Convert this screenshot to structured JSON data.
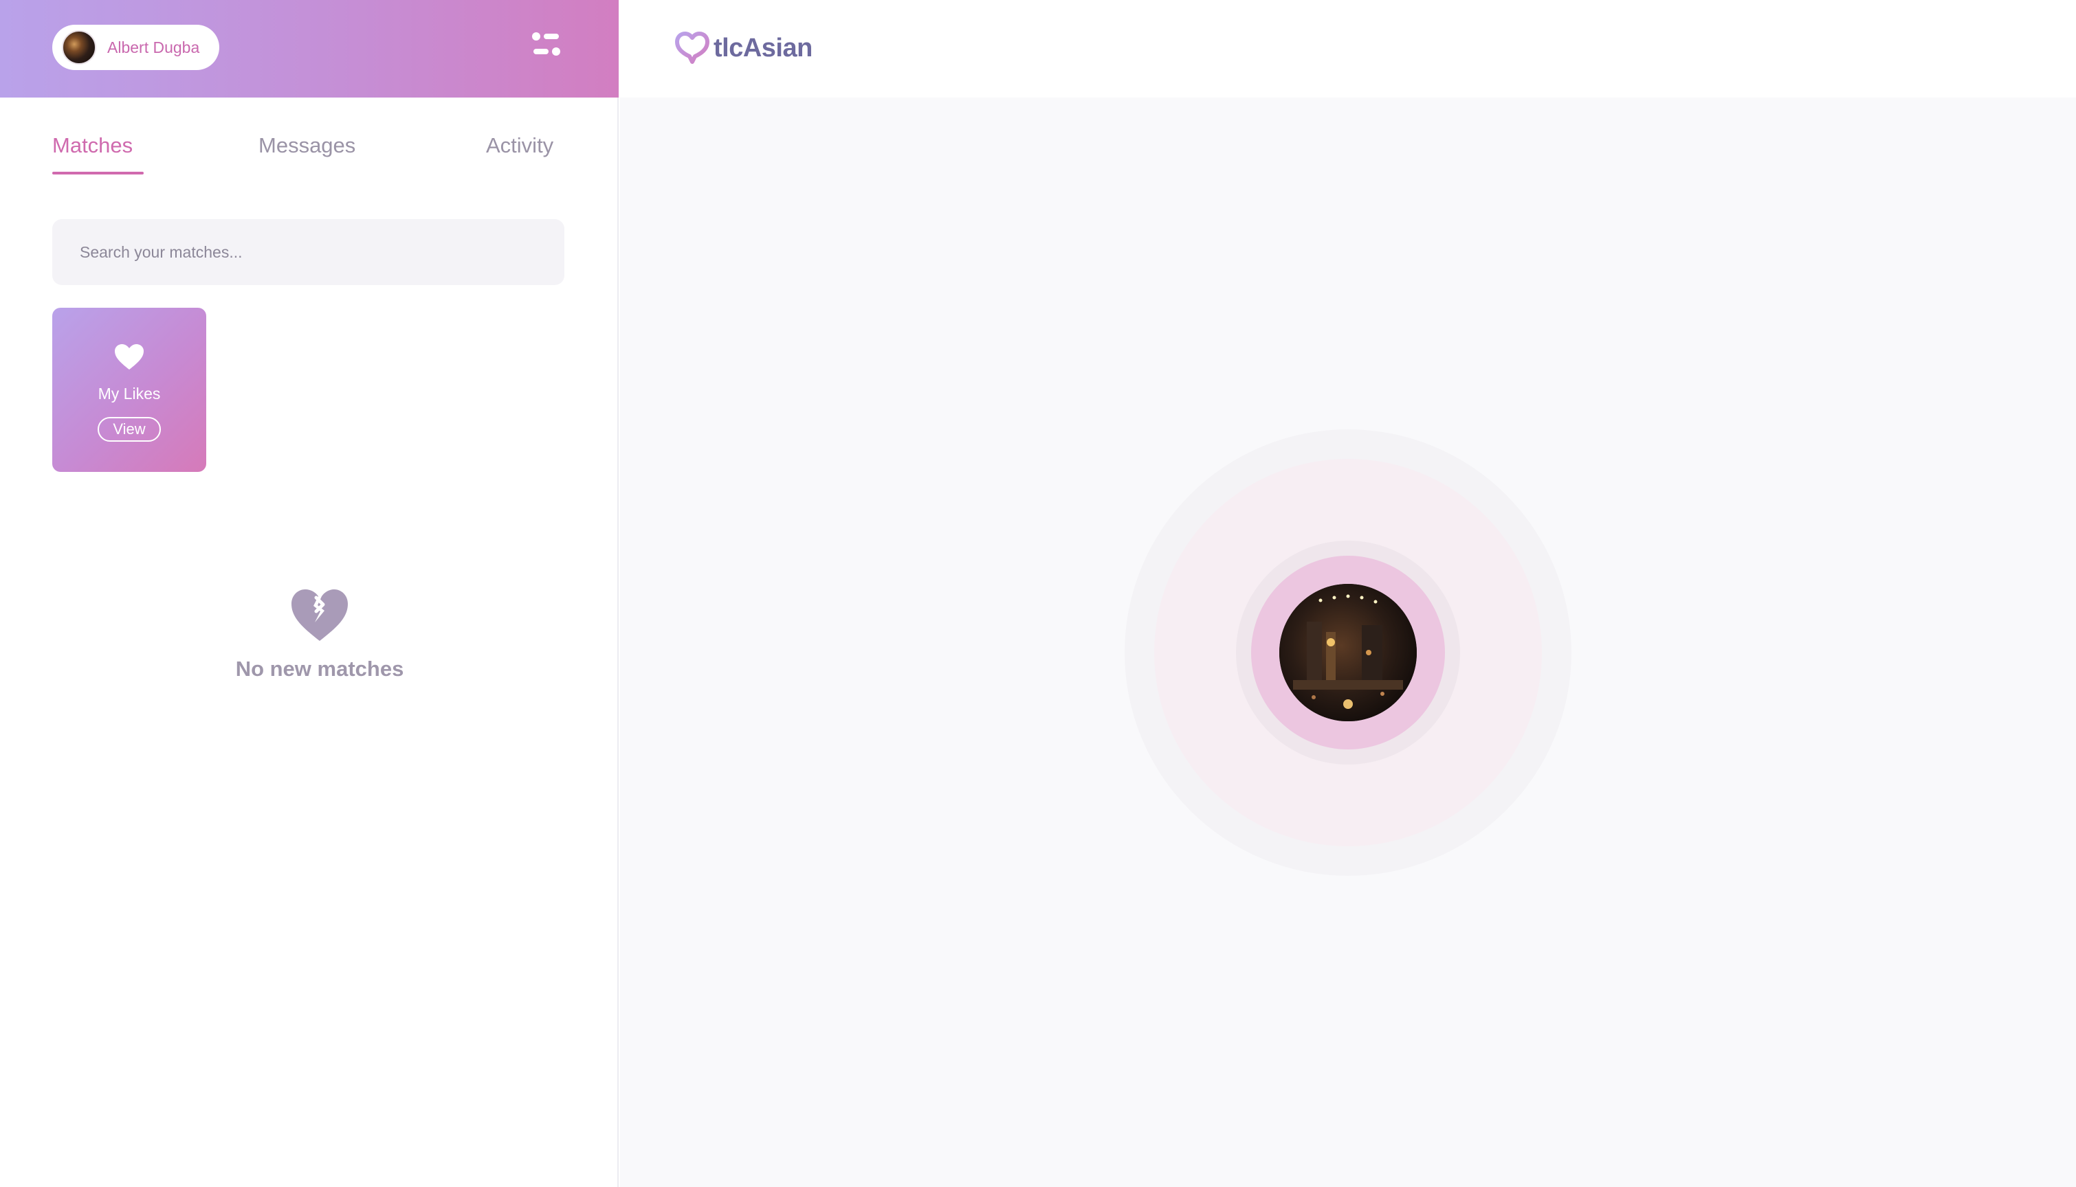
{
  "user": {
    "name": "Albert Dugba"
  },
  "tabs": [
    {
      "label": "Matches",
      "active": true
    },
    {
      "label": "Messages",
      "active": false
    },
    {
      "label": "Activity",
      "active": false
    }
  ],
  "search": {
    "placeholder": "Search your matches..."
  },
  "likes_card": {
    "label": "My Likes",
    "button": "View"
  },
  "empty_state": {
    "text": "No new matches",
    "icon": "broken-heart-icon"
  },
  "brand": {
    "name": "tlcAsian",
    "logo_icon": "heart-chat-icon"
  },
  "colors": {
    "accent": "#cf6aae",
    "gradient_start": "#b9a2ea",
    "gradient_end": "#d27ec1",
    "logo_text": "#6d6a9e"
  }
}
